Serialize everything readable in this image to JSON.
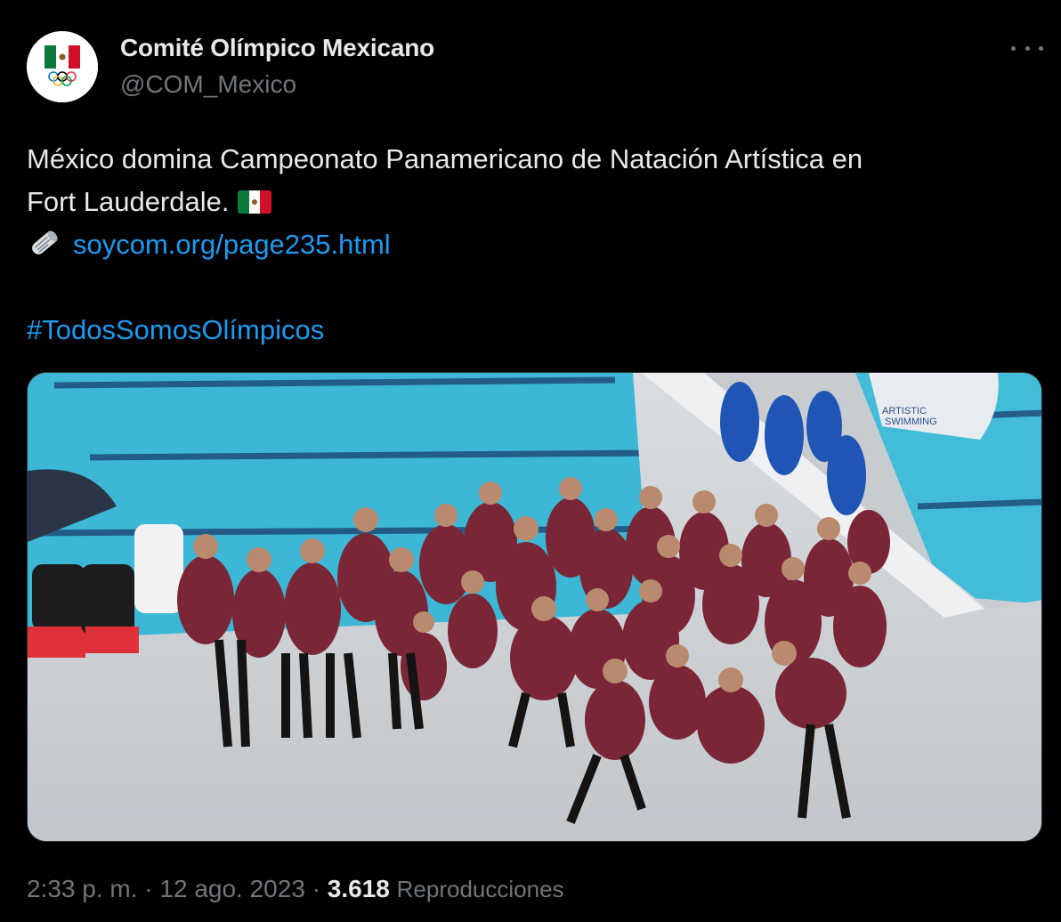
{
  "author": {
    "name": "Comité Olímpico Mexicano",
    "handle": "@COM_Mexico",
    "avatar_icon": "mexico-olympic-committee-logo"
  },
  "tweet": {
    "line1": "México domina Campeonato Panamericano de Natación Artística en",
    "line2": "Fort Lauderdale.",
    "link_text": "soycom.org/page235.html",
    "hashtag": "#TodosSomosOlímpicos"
  },
  "media": {
    "banner_text_1": "ARTISTIC",
    "banner_text_2": "SWIMMING"
  },
  "meta": {
    "time": "2:33 p. m.",
    "separator": "·",
    "date": "12 ago. 2023",
    "views_count": "3.618",
    "views_label": "Reproducciones"
  },
  "colors": {
    "background": "#000000",
    "text_primary": "#e7e9ea",
    "text_secondary": "#71767b",
    "link": "#1d9bf0",
    "pool_water": "#3cb7d6",
    "uniform_maroon": "#7a2637"
  }
}
